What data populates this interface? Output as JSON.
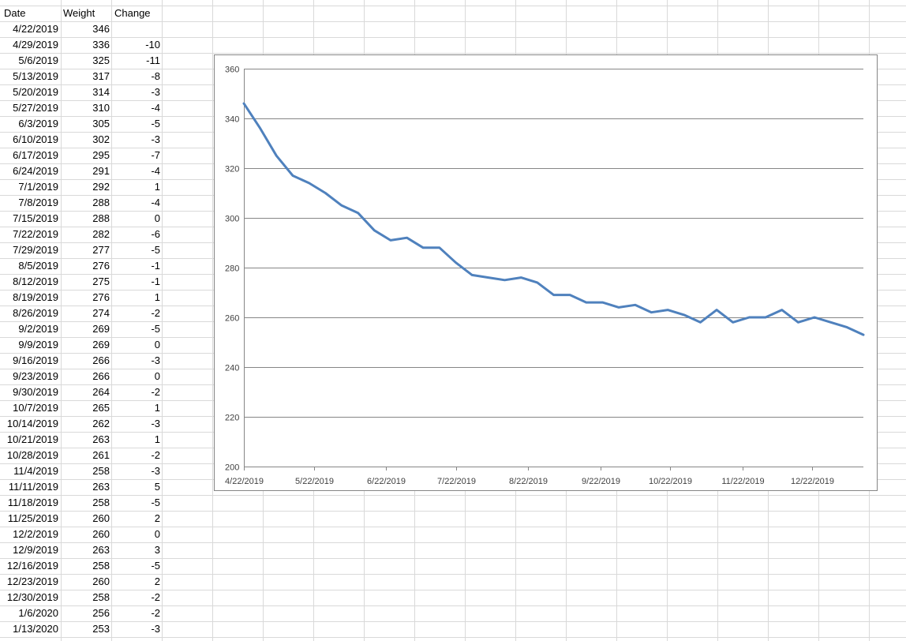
{
  "sheet": {
    "headers": [
      "Date",
      "Weight",
      "Change"
    ],
    "rows": [
      {
        "date": "4/22/2019",
        "weight": "346",
        "change": ""
      },
      {
        "date": "4/29/2019",
        "weight": "336",
        "change": "-10"
      },
      {
        "date": "5/6/2019",
        "weight": "325",
        "change": "-11"
      },
      {
        "date": "5/13/2019",
        "weight": "317",
        "change": "-8"
      },
      {
        "date": "5/20/2019",
        "weight": "314",
        "change": "-3"
      },
      {
        "date": "5/27/2019",
        "weight": "310",
        "change": "-4"
      },
      {
        "date": "6/3/2019",
        "weight": "305",
        "change": "-5"
      },
      {
        "date": "6/10/2019",
        "weight": "302",
        "change": "-3"
      },
      {
        "date": "6/17/2019",
        "weight": "295",
        "change": "-7"
      },
      {
        "date": "6/24/2019",
        "weight": "291",
        "change": "-4"
      },
      {
        "date": "7/1/2019",
        "weight": "292",
        "change": "1"
      },
      {
        "date": "7/8/2019",
        "weight": "288",
        "change": "-4"
      },
      {
        "date": "7/15/2019",
        "weight": "288",
        "change": "0"
      },
      {
        "date": "7/22/2019",
        "weight": "282",
        "change": "-6"
      },
      {
        "date": "7/29/2019",
        "weight": "277",
        "change": "-5"
      },
      {
        "date": "8/5/2019",
        "weight": "276",
        "change": "-1"
      },
      {
        "date": "8/12/2019",
        "weight": "275",
        "change": "-1"
      },
      {
        "date": "8/19/2019",
        "weight": "276",
        "change": "1"
      },
      {
        "date": "8/26/2019",
        "weight": "274",
        "change": "-2"
      },
      {
        "date": "9/2/2019",
        "weight": "269",
        "change": "-5"
      },
      {
        "date": "9/9/2019",
        "weight": "269",
        "change": "0"
      },
      {
        "date": "9/16/2019",
        "weight": "266",
        "change": "-3"
      },
      {
        "date": "9/23/2019",
        "weight": "266",
        "change": "0"
      },
      {
        "date": "9/30/2019",
        "weight": "264",
        "change": "-2"
      },
      {
        "date": "10/7/2019",
        "weight": "265",
        "change": "1"
      },
      {
        "date": "10/14/2019",
        "weight": "262",
        "change": "-3"
      },
      {
        "date": "10/21/2019",
        "weight": "263",
        "change": "1"
      },
      {
        "date": "10/28/2019",
        "weight": "261",
        "change": "-2"
      },
      {
        "date": "11/4/2019",
        "weight": "258",
        "change": "-3"
      },
      {
        "date": "11/11/2019",
        "weight": "263",
        "change": "5"
      },
      {
        "date": "11/18/2019",
        "weight": "258",
        "change": "-5"
      },
      {
        "date": "11/25/2019",
        "weight": "260",
        "change": "2"
      },
      {
        "date": "12/2/2019",
        "weight": "260",
        "change": "0"
      },
      {
        "date": "12/9/2019",
        "weight": "263",
        "change": "3"
      },
      {
        "date": "12/16/2019",
        "weight": "258",
        "change": "-5"
      },
      {
        "date": "12/23/2019",
        "weight": "260",
        "change": "2"
      },
      {
        "date": "12/30/2019",
        "weight": "258",
        "change": "-2"
      },
      {
        "date": "1/6/2020",
        "weight": "256",
        "change": "-2"
      },
      {
        "date": "1/13/2020",
        "weight": "253",
        "change": "-3"
      }
    ]
  },
  "colors": {
    "gridline": "#d9d9d9",
    "series_line": "#4f81bd",
    "chart_border": "#868686",
    "chart_gridline": "#868686"
  },
  "chart_data": {
    "type": "line",
    "title": "",
    "xlabel": "",
    "ylabel": "",
    "x_axis_type": "date",
    "xlim": [
      "4/22/2019",
      "1/13/2020"
    ],
    "ylim": [
      200,
      360
    ],
    "y_ticks": [
      200,
      220,
      240,
      260,
      280,
      300,
      320,
      340,
      360
    ],
    "x_tick_labels": [
      "4/22/2019",
      "5/22/2019",
      "6/22/2019",
      "7/22/2019",
      "8/22/2019",
      "9/22/2019",
      "10/22/2019",
      "11/22/2019",
      "12/22/2019"
    ],
    "grid": true,
    "legend": "none",
    "series": [
      {
        "x": [
          "4/22/2019",
          "4/29/2019",
          "5/6/2019",
          "5/13/2019",
          "5/20/2019",
          "5/27/2019",
          "6/3/2019",
          "6/10/2019",
          "6/17/2019",
          "6/24/2019",
          "7/1/2019",
          "7/8/2019",
          "7/15/2019",
          "7/22/2019",
          "7/29/2019",
          "8/5/2019",
          "8/12/2019",
          "8/19/2019",
          "8/26/2019",
          "9/2/2019",
          "9/9/2019",
          "9/16/2019",
          "9/23/2019",
          "9/30/2019",
          "10/7/2019",
          "10/14/2019",
          "10/21/2019",
          "10/28/2019",
          "11/4/2019",
          "11/11/2019",
          "11/18/2019",
          "11/25/2019",
          "12/2/2019",
          "12/9/2019",
          "12/16/2019",
          "12/23/2019",
          "12/30/2019",
          "1/6/2020",
          "1/13/2020"
        ],
        "values": [
          346,
          336,
          325,
          317,
          314,
          310,
          305,
          302,
          295,
          291,
          292,
          288,
          288,
          282,
          277,
          276,
          275,
          276,
          274,
          269,
          269,
          266,
          266,
          264,
          265,
          262,
          263,
          261,
          258,
          263,
          258,
          260,
          260,
          263,
          258,
          260,
          258,
          256,
          253
        ]
      }
    ]
  }
}
